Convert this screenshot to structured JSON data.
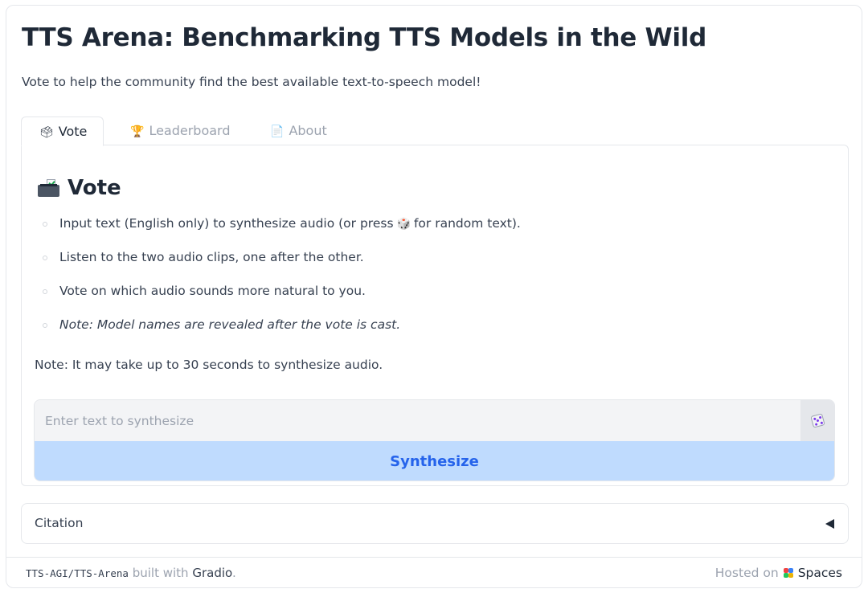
{
  "header": {
    "title": "TTS Arena: Benchmarking TTS Models in the Wild",
    "subtitle": "Vote to help the community find the best available text-to-speech model!"
  },
  "tabs": [
    {
      "label": "Vote",
      "icon": "ballot-box-icon",
      "active": true
    },
    {
      "label": "Leaderboard",
      "icon": "trophy-icon",
      "active": false
    },
    {
      "label": "About",
      "icon": "page-icon",
      "active": false
    }
  ],
  "vote_panel": {
    "heading": "Vote",
    "bullets": [
      {
        "before": "Input text (English only) to synthesize audio (or press",
        "icon": "dice-icon",
        "after": "for random text)."
      },
      {
        "text": "Listen to the two audio clips, one after the other."
      },
      {
        "text": "Vote on which audio sounds more natural to you."
      },
      {
        "text": "Note: Model names are revealed after the vote is cast."
      }
    ],
    "note": "Note: It may take up to 30 seconds to synthesize audio.",
    "input": {
      "placeholder": "Enter text to synthesize",
      "value": ""
    },
    "random_button_icon": "dice-icon",
    "synthesize_label": "Synthesize"
  },
  "citation": {
    "label": "Citation"
  },
  "footer": {
    "repo": "TTS-AGI/TTS-Arena",
    "built_with": "built with",
    "gradio": "Gradio",
    "period": ".",
    "hosted_on": "Hosted on",
    "spaces": "Spaces"
  },
  "colors": {
    "accent": "#2563eb",
    "synthesize_bg": "#bfdbfe",
    "border": "#e5e7eb",
    "muted_text": "#9ca3af"
  }
}
